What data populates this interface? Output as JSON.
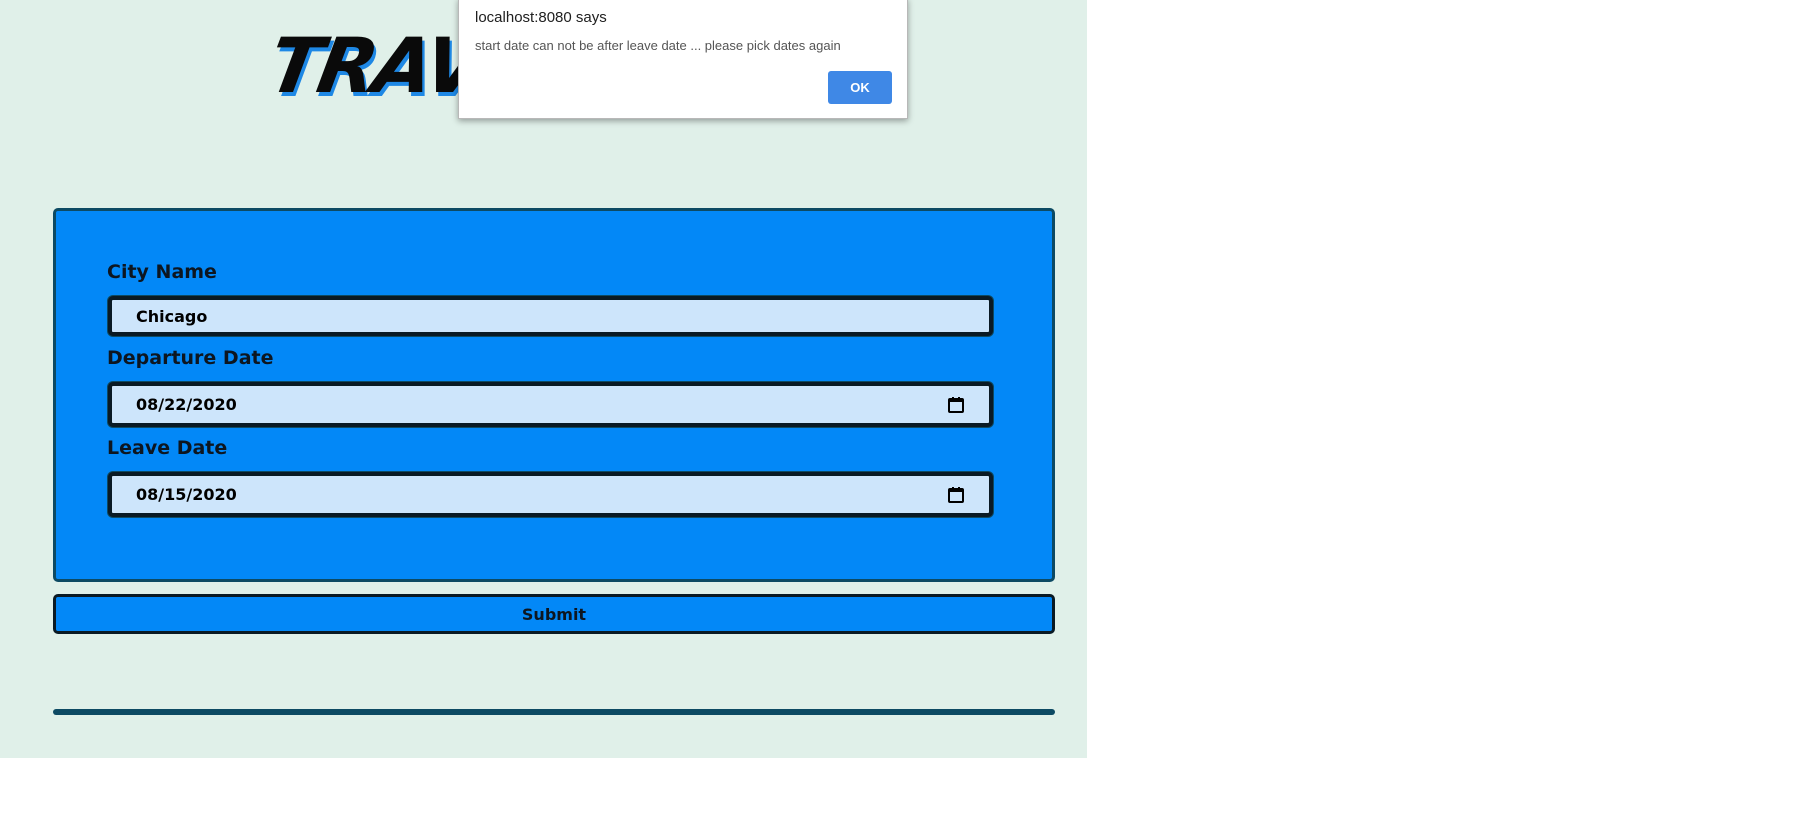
{
  "logo": {
    "text": "TRAVC"
  },
  "form": {
    "city": {
      "label": "City Name",
      "value": "Chicago"
    },
    "departure": {
      "label": "Departure Date",
      "value": "08/22/2020"
    },
    "leave": {
      "label": "Leave Date",
      "value": "08/15/2020"
    },
    "submit_label": "Submit"
  },
  "dialog": {
    "title": "localhost:8080 says",
    "message": "start date can not be after leave date ... please pick dates again",
    "ok_label": "OK"
  },
  "colors": {
    "page_bg": "#e0f0e9",
    "panel": "#0388f7",
    "field_bg": "#cde5fb",
    "border_dark": "#0d4a63",
    "dialog_button": "#3f88e6"
  }
}
